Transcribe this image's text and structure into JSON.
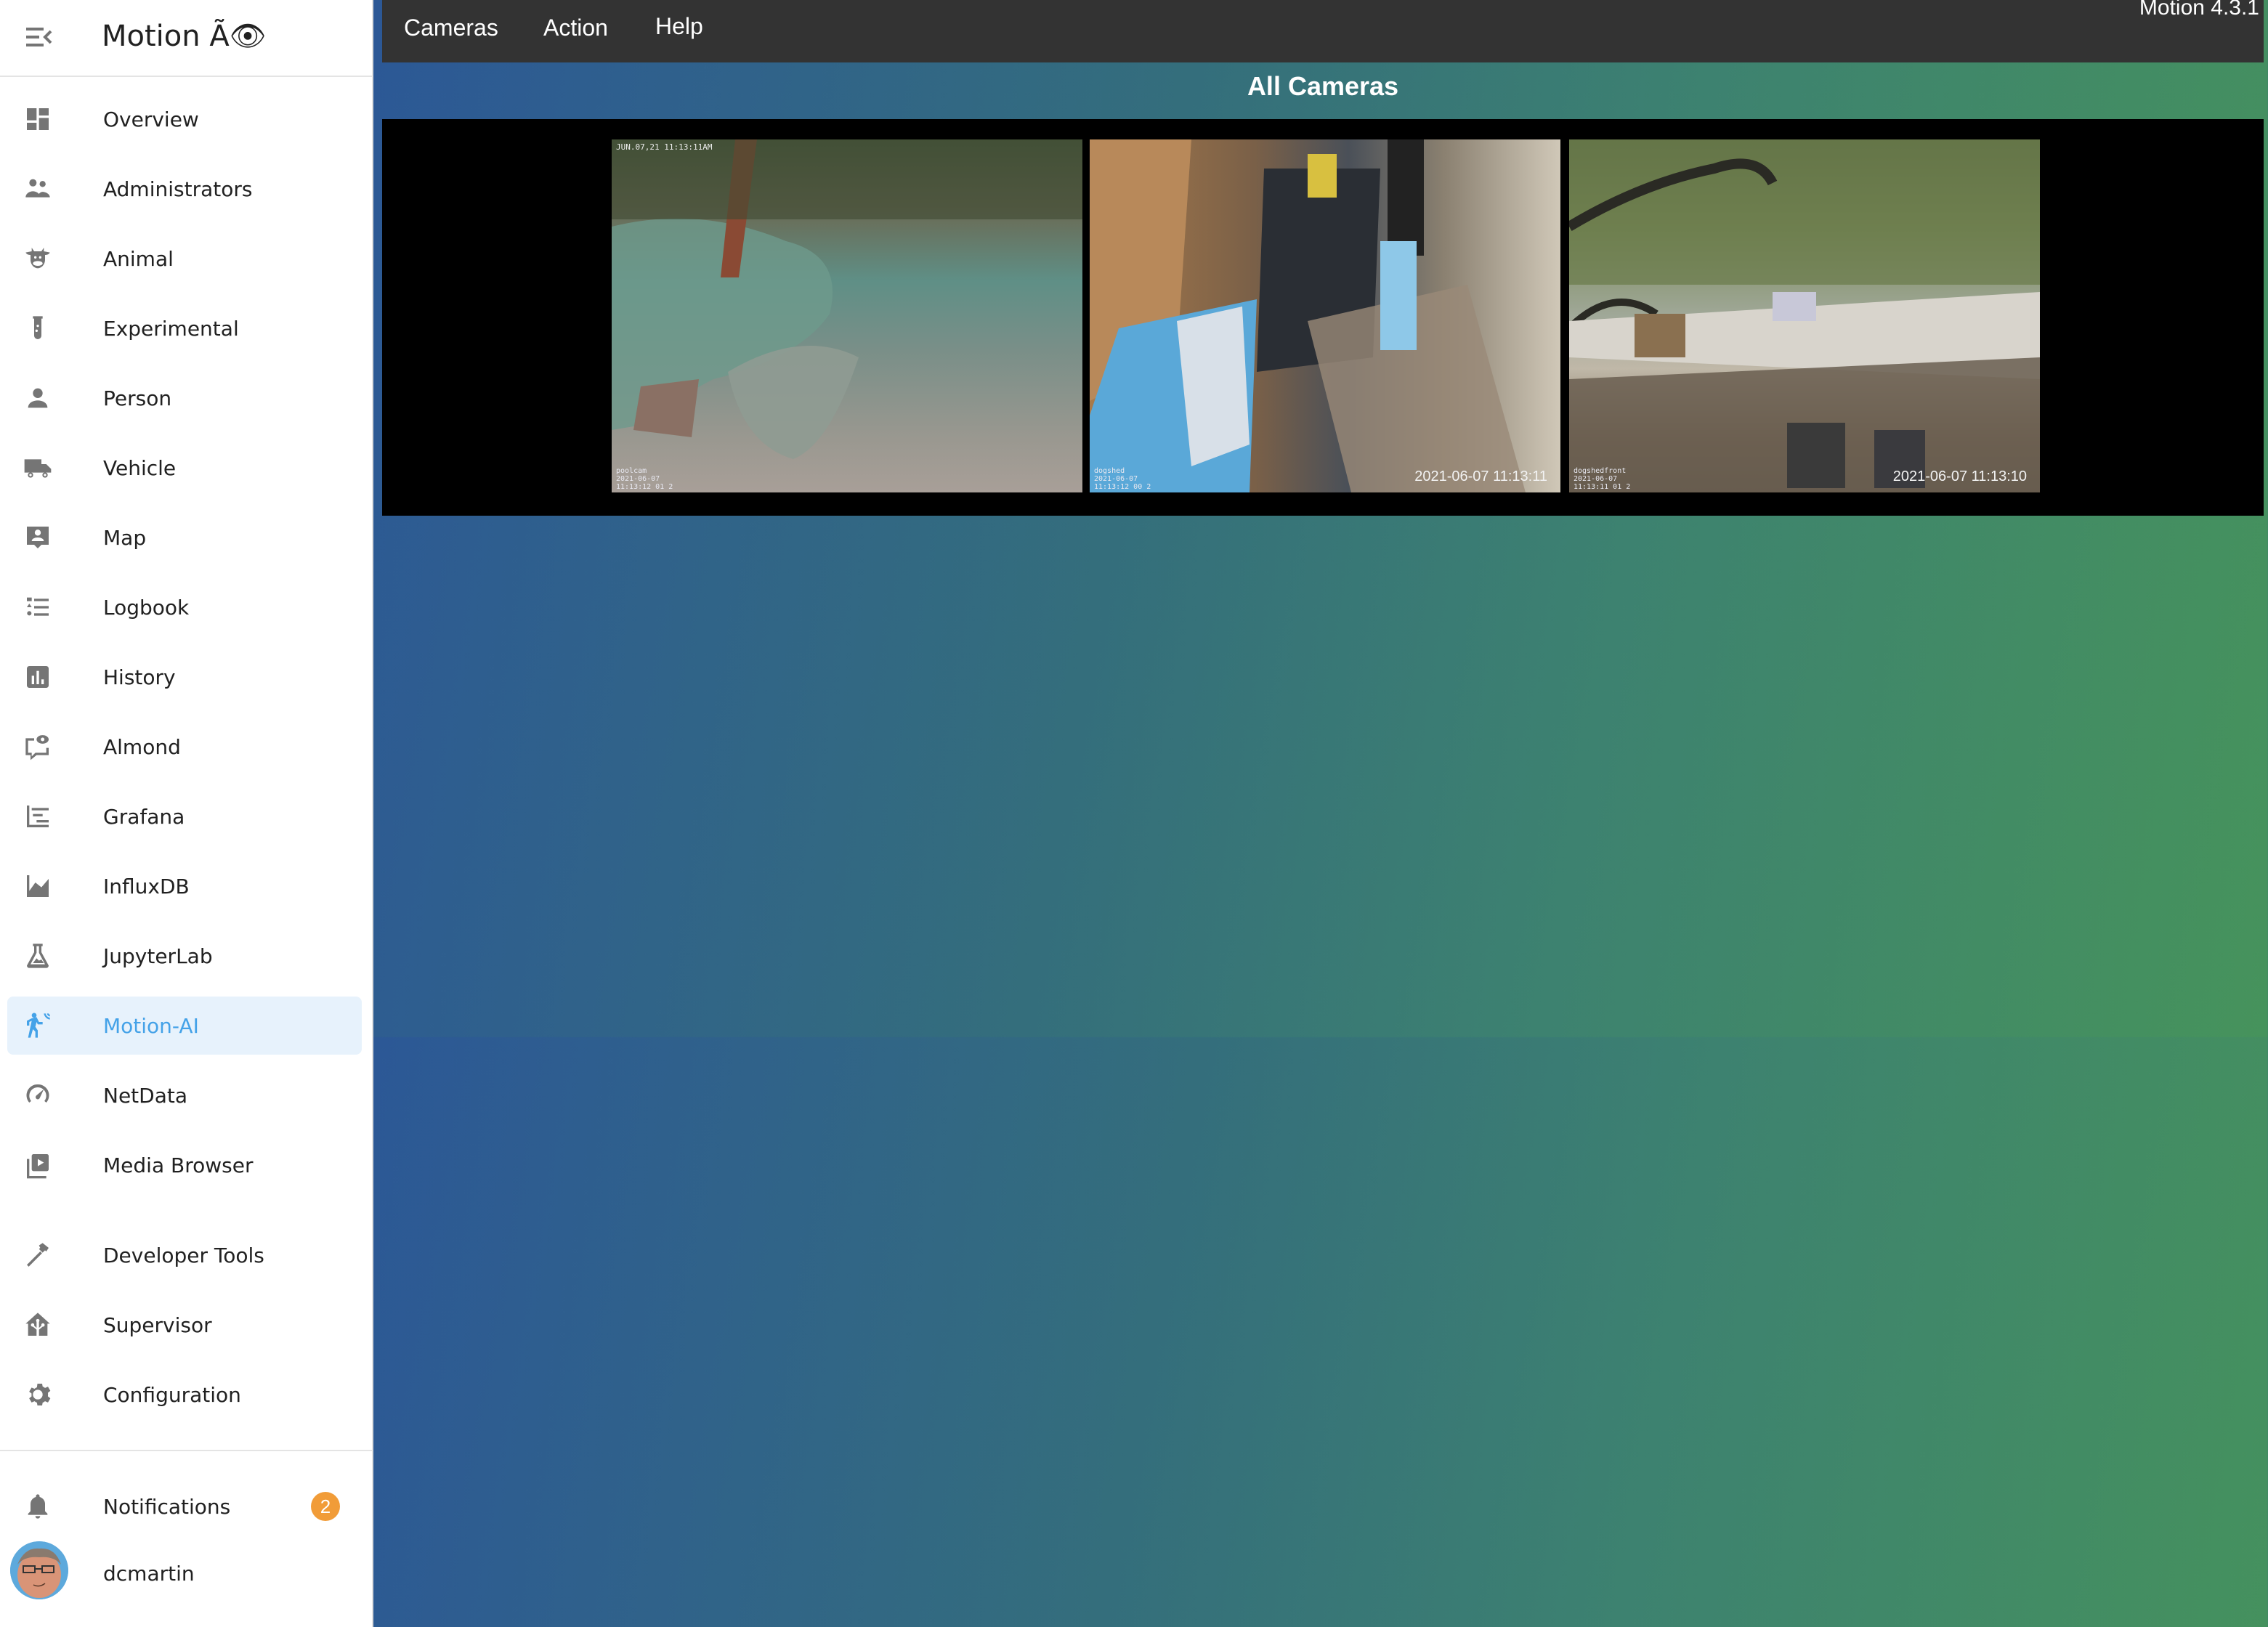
{
  "sidebar": {
    "title": "Motion Ã👁",
    "items": [
      {
        "label": "Overview",
        "icon": "dashboard-icon"
      },
      {
        "label": "Administrators",
        "icon": "account-group-icon"
      },
      {
        "label": "Animal",
        "icon": "cow-icon"
      },
      {
        "label": "Experimental",
        "icon": "test-tube-icon"
      },
      {
        "label": "Person",
        "icon": "account-icon"
      },
      {
        "label": "Vehicle",
        "icon": "truck-icon"
      },
      {
        "label": "Map",
        "icon": "map-account-icon"
      },
      {
        "label": "Logbook",
        "icon": "format-list-icon"
      },
      {
        "label": "History",
        "icon": "chart-box-icon"
      },
      {
        "label": "Almond",
        "icon": "message-eye-icon"
      },
      {
        "label": "Grafana",
        "icon": "chart-timeline-icon"
      },
      {
        "label": "InfluxDB",
        "icon": "chart-areaspline-icon"
      },
      {
        "label": "JupyterLab",
        "icon": "flask-icon"
      },
      {
        "label": "Motion-AI",
        "icon": "motion-sensor-icon",
        "active": true
      },
      {
        "label": "NetData",
        "icon": "speedometer-icon"
      },
      {
        "label": "Media Browser",
        "icon": "play-box-multiple-icon"
      }
    ],
    "tools": [
      {
        "label": "Developer Tools",
        "icon": "hammer-icon"
      },
      {
        "label": "Supervisor",
        "icon": "home-assistant-icon"
      },
      {
        "label": "Configuration",
        "icon": "cog-icon"
      }
    ],
    "notifications": {
      "label": "Notifications",
      "count": "2"
    },
    "user": {
      "name": "dcmartin"
    }
  },
  "menubar": {
    "items": [
      "Cameras",
      "Action",
      "Help"
    ],
    "version": "Motion 4.3.1"
  },
  "main": {
    "heading": "All Cameras",
    "cameras": [
      {
        "name": "poolcam",
        "timestamp_top": "JUN.07,21 11:13:11AM",
        "timestamp_br": "",
        "overlay": "poolcam\n2021-06-07\n11:13:12 01 2"
      },
      {
        "name": "dogshed",
        "timestamp_top": "",
        "timestamp_br": "2021-06-07 11:13:11",
        "overlay": "dogshed\n2021-06-07\n11:13:12 00 2"
      },
      {
        "name": "dogshedfront",
        "timestamp_top": "",
        "timestamp_br": "2021-06-07 11:13:10",
        "overlay": "dogshedfront\n2021-06-07\n11:13:11 01 2"
      }
    ]
  },
  "colors": {
    "accent": "#44a2e8",
    "badge": "#f19c38",
    "menubar": "#333333",
    "gradient_start": "#2c5896",
    "gradient_end": "#46935c"
  }
}
